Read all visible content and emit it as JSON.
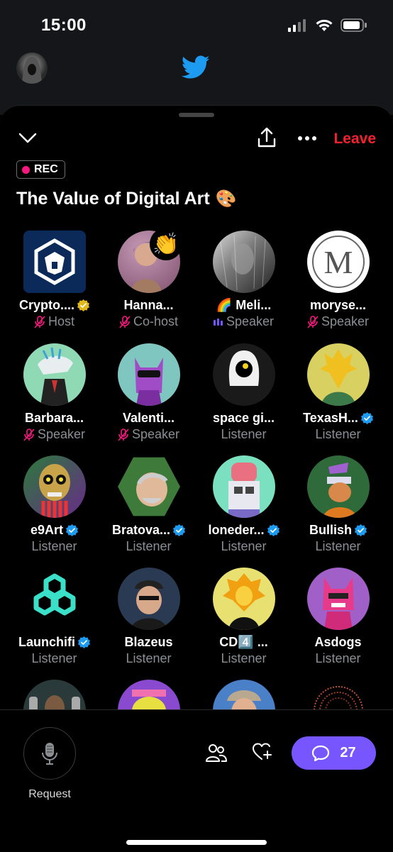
{
  "status_bar": {
    "time": "15:00"
  },
  "space": {
    "leave_label": "Leave",
    "rec_label": "REC",
    "title": "The Value of Digital Art",
    "title_emoji": "🎨"
  },
  "participants": [
    {
      "name": "Crypto....",
      "role": "Host",
      "verified": "gold",
      "muted": true
    },
    {
      "name": "Hanna...",
      "role": "Co-host",
      "verified": "",
      "muted": true,
      "reaction": "👏"
    },
    {
      "name": "🌈 Meli...",
      "role": "Speaker",
      "verified": "",
      "speaking": true
    },
    {
      "name": "moryse...",
      "role": "Speaker",
      "verified": "",
      "muted": true
    },
    {
      "name": "Barbara...",
      "role": "Speaker",
      "verified": "",
      "muted": true
    },
    {
      "name": "Valenti...",
      "role": "Speaker",
      "verified": "",
      "muted": true
    },
    {
      "name": "space gi...",
      "role": "Listener",
      "verified": ""
    },
    {
      "name": "TexasH...",
      "role": "Listener",
      "verified": "blue"
    },
    {
      "name": "e9Art",
      "role": "Listener",
      "verified": "blue"
    },
    {
      "name": "Bratova...",
      "role": "Listener",
      "verified": "blue"
    },
    {
      "name": "loneder...",
      "role": "Listener",
      "verified": "blue"
    },
    {
      "name": "Bullish",
      "role": "Listener",
      "verified": "blue"
    },
    {
      "name": "Launchifi",
      "role": "Listener",
      "verified": "blue"
    },
    {
      "name": "Blazeus",
      "role": "Listener",
      "verified": ""
    },
    {
      "name": "CD4️⃣ ...",
      "role": "Listener",
      "verified": ""
    },
    {
      "name": "Asdogs",
      "role": "Listener",
      "verified": ""
    }
  ],
  "bottom_bar": {
    "request_label": "Request",
    "comment_count": "27"
  },
  "colors": {
    "accent": "#7856ff",
    "leave": "#f4212e",
    "muted_icon": "#f91880",
    "verified_blue": "#1d9bf0",
    "verified_gold": "#e2b719"
  }
}
